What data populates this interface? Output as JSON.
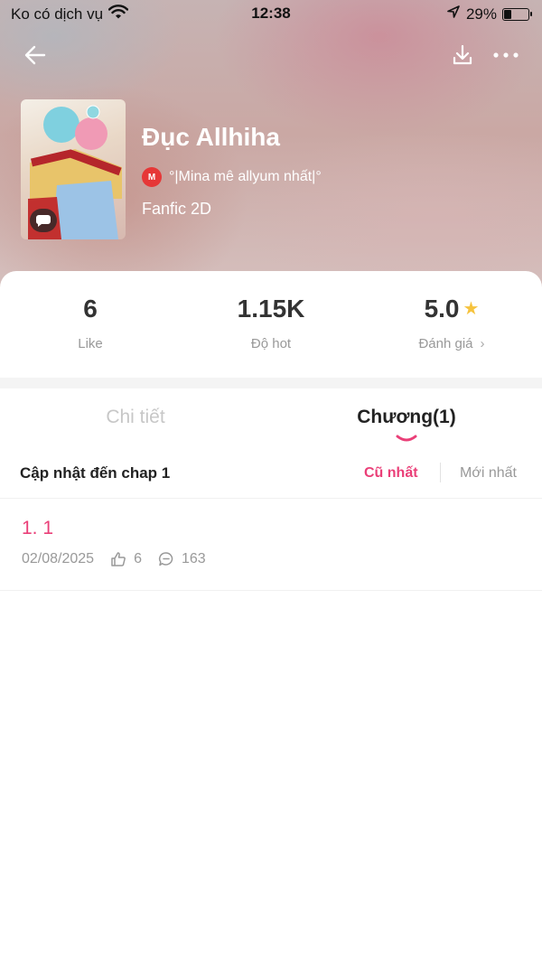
{
  "status_bar": {
    "carrier": "Ko có dịch vụ",
    "time": "12:38",
    "battery": "29%",
    "battery_level": 0.29
  },
  "header": {
    "back_icon": "arrow-left-icon",
    "download_icon": "download-icon",
    "more_icon": "more-horizontal-icon"
  },
  "book": {
    "title": "Đục Allhiha",
    "author_badge": "M",
    "author": "°|Mina mê allyum nhất|°",
    "genre": "Fanfic 2D"
  },
  "stats": {
    "likes": {
      "value": "6",
      "label": "Like"
    },
    "hot": {
      "value": "1.15K",
      "label": "Độ hot"
    },
    "rating": {
      "value": "5.0",
      "label": "Đánh giá"
    }
  },
  "tabs": [
    {
      "label": "Chi tiết",
      "active": false
    },
    {
      "label": "Chương(1)",
      "active": true
    }
  ],
  "chapters_header": {
    "update_text": "Cập nhật đến chap 1",
    "sort_oldest": "Cũ nhất",
    "sort_newest": "Mới nhất"
  },
  "chapters": [
    {
      "title": "1. 1",
      "date": "02/08/2025",
      "likes": "6",
      "comments": "163"
    }
  ],
  "colors": {
    "accent": "#ea3f78",
    "star": "#f6c33e",
    "muted": "#999999"
  }
}
